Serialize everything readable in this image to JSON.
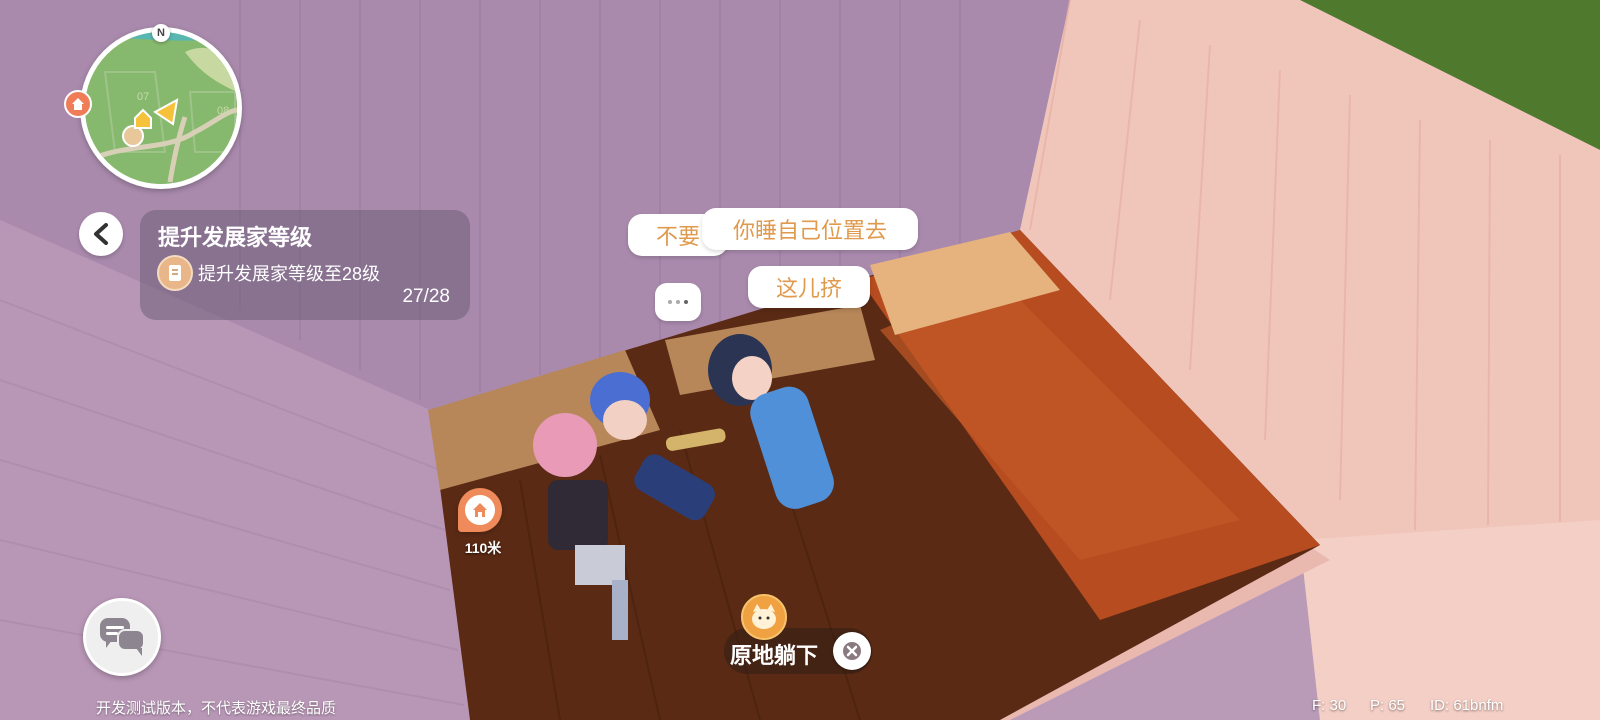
{
  "minimap": {
    "compass": "N",
    "zone_labels": [
      "07",
      "08"
    ]
  },
  "quest": {
    "title": "提升发展家等级",
    "description": "提升发展家等级至28级",
    "progress": "27/28"
  },
  "chat_bubbles": {
    "bubble_1": "不要",
    "bubble_2": "你睡自己位置去",
    "bubble_3": "这儿挤"
  },
  "distance_marker": {
    "label": "110米"
  },
  "action": {
    "label": "原地躺下"
  },
  "footer": {
    "disclaimer": "开发测试版本，不代表游戏最终品质",
    "fps": "F: 30",
    "ping": "P: 65",
    "player_id": "ID: 61bnfm"
  }
}
